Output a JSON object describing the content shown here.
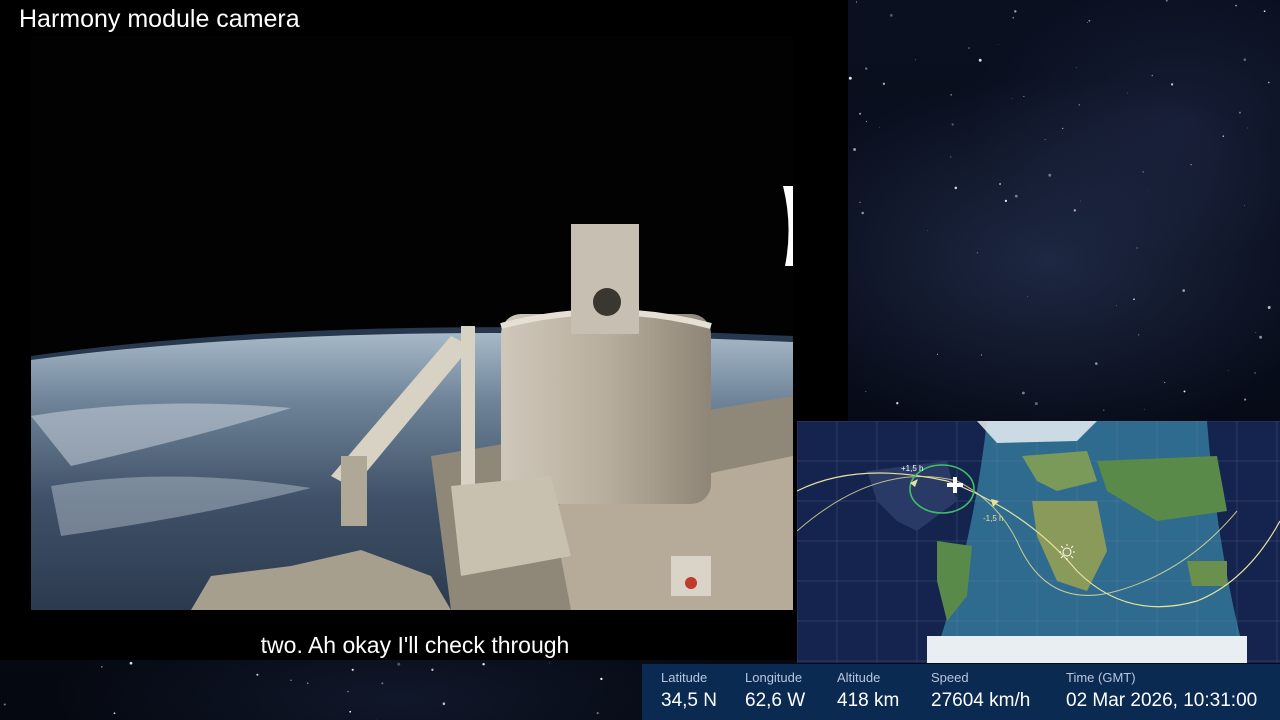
{
  "header": {
    "title": "Harmony module camera"
  },
  "subtitle": {
    "text": "two. Ah okay I'll check through"
  },
  "map": {
    "marker_plus": "+1,5 h",
    "marker_minus": "-1,5 h",
    "sun_icon": "sun-icon",
    "iss_icon": "iss-icon",
    "colors": {
      "day": "#2f6b8f",
      "night": "#142552",
      "track": "#e6e29a",
      "orbit_ring": "#3fbf6a"
    }
  },
  "telemetry": {
    "latitude": {
      "label": "Latitude",
      "value": "34,5 N"
    },
    "longitude": {
      "label": "Longitude",
      "value": "62,6 W"
    },
    "altitude": {
      "label": "Altitude",
      "value": "418 km"
    },
    "speed": {
      "label": "Speed",
      "value": "27604 km/h"
    },
    "time": {
      "label": "Time (GMT)",
      "value": "02 Mar 2026, 10:31:00"
    }
  }
}
